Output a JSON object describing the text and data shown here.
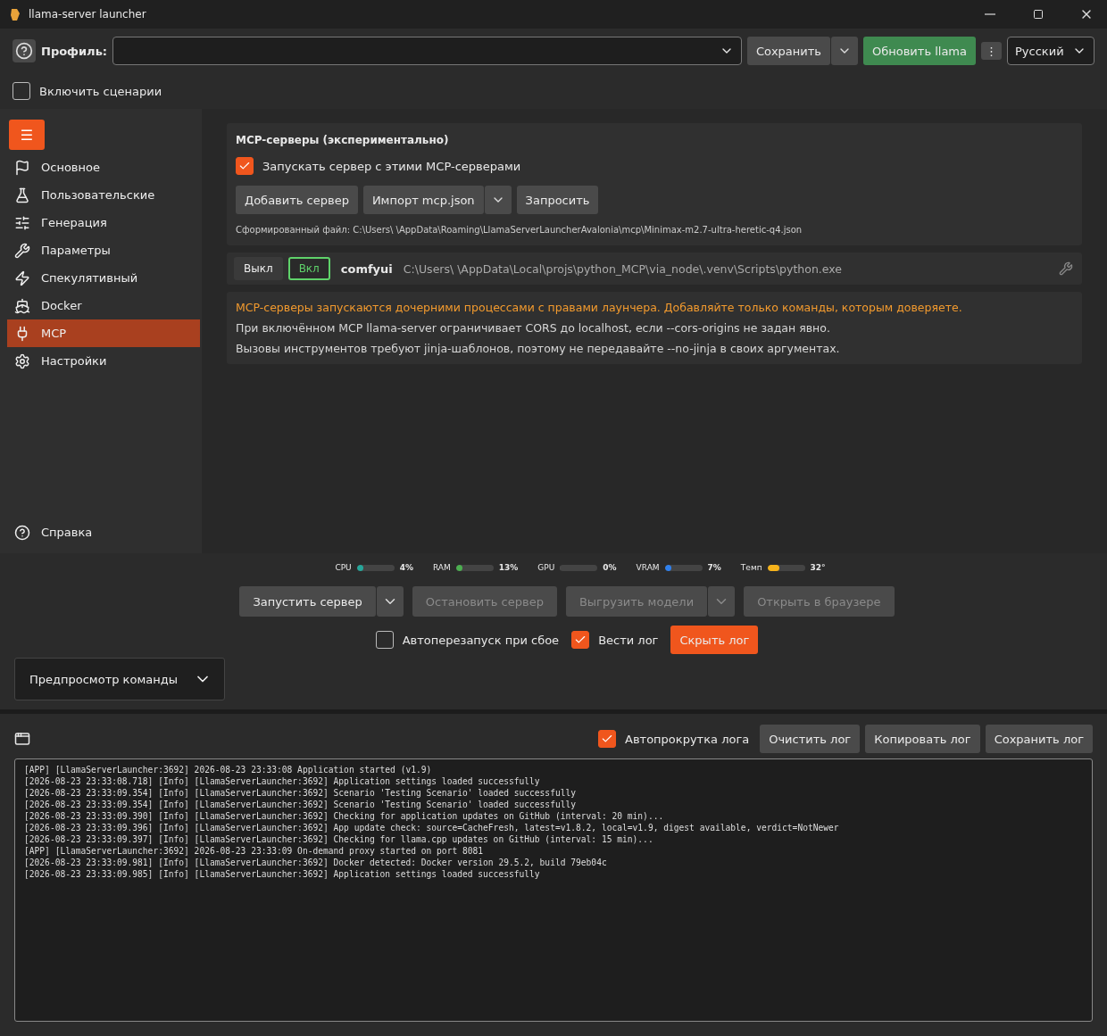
{
  "window": {
    "title": "llama-server launcher"
  },
  "toolbar": {
    "profile_label": "Профиль:",
    "save": "Сохранить",
    "update": "Обновить llama",
    "more": "⋮",
    "language": "Русский"
  },
  "scenarios": {
    "label": "Включить сценарии",
    "checked": false
  },
  "sidebar": {
    "menu": "☰",
    "items": [
      {
        "label": "Основное",
        "selected": false
      },
      {
        "label": "Пользовательские",
        "selected": false
      },
      {
        "label": "Генерация",
        "selected": false
      },
      {
        "label": "Параметры",
        "selected": false
      },
      {
        "label": "Спекулятивный",
        "selected": false
      },
      {
        "label": "Docker",
        "selected": false
      },
      {
        "label": "MCP",
        "selected": true
      },
      {
        "label": "Настройки",
        "selected": false
      }
    ],
    "help": "Справка"
  },
  "mcp": {
    "title": "MCP-серверы (экспериментально)",
    "run_with": {
      "label": "Запускать сервер с этими MCP-серверами",
      "checked": true
    },
    "buttons": [
      "Добавить сервер",
      "Импорт mcp.json",
      "Запросить"
    ],
    "generated_file": "Сформированный файл: C:\\Users\\ \\AppData\\Roaming\\LlamaServerLauncherAvalonia\\mcp\\Minimax-m2.7-ultra-heretic-q4.json",
    "servers": [
      {
        "off": "Выкл",
        "on": "Вкл",
        "enabled": true,
        "name": "comfyui",
        "command": "C:\\Users\\ \\AppData\\Local\\projs\\python_MCP\\via_node\\.venv\\Scripts\\python.exe"
      }
    ],
    "notes": [
      {
        "text": "MCP-серверы запускаются дочерними процессами с правами лаунчера. Добавляйте только команды, которым доверяете.",
        "kind": "warning"
      },
      {
        "text": "При включённом MCP llama-server ограничивает CORS до localhost, если --cors-origins не задан явно.",
        "kind": "info"
      },
      {
        "text": "Вызовы инструментов требуют jinja-шаблонов, поэтому не передавайте --no-jinja в своих аргументах.",
        "kind": "info"
      }
    ]
  },
  "meters": [
    {
      "label": "CPU",
      "level": 0.04,
      "reading": "4%",
      "color": "#26a69a"
    },
    {
      "label": "RAM",
      "level": 0.13,
      "reading": "13%",
      "color": "#4caf50"
    },
    {
      "label": "GPU",
      "level": 0,
      "reading": "0%"
    },
    {
      "label": "VRAM",
      "level": 0.07,
      "reading": "7%",
      "color": "#2f80ed"
    },
    {
      "label": "Темп",
      "level": 0.32,
      "reading": "32°",
      "color": "#f5b21b"
    }
  ],
  "actions": [
    {
      "label": "Запустить сервер",
      "disabled": false,
      "dropdown": true
    },
    {
      "label": "Остановить сервер",
      "disabled": true,
      "dropdown": false
    },
    {
      "label": "Выгрузить модели",
      "disabled": true,
      "dropdown": true
    },
    {
      "label": "Открыть в браузере",
      "disabled": true,
      "dropdown": false
    }
  ],
  "options": [
    {
      "label": "Автоперезапуск при сбое",
      "checked": false
    },
    {
      "label": "Вести лог",
      "checked": true
    }
  ],
  "hide_log": "Скрыть лог",
  "preview": "Предпросмотр команды",
  "log": {
    "autoscroll": {
      "label": "Автопрокрутка лога",
      "checked": true
    },
    "buttons": [
      "Очистить лог",
      "Копировать лог",
      "Сохранить лог"
    ],
    "lines": [
      "[APP] [LlamaServerLauncher:3692] 2026-08-23 23:33:08 Application started (v1.9)",
      "[2026-08-23 23:33:08.718] [Info] [LlamaServerLauncher:3692] Application settings loaded successfully",
      "[2026-08-23 23:33:09.354] [Info] [LlamaServerLauncher:3692] Scenario 'Testing Scenario' loaded successfully",
      "[2026-08-23 23:33:09.354] [Info] [LlamaServerLauncher:3692] Scenario 'Testing Scenario' loaded successfully",
      "[2026-08-23 23:33:09.390] [Info] [LlamaServerLauncher:3692] Checking for application updates on GitHub (interval: 20 min)...",
      "[2026-08-23 23:33:09.396] [Info] [LlamaServerLauncher:3692] App update check: source=CacheFresh, latest=v1.8.2, local=v1.9, digest available, verdict=NotNewer",
      "[2026-08-23 23:33:09.397] [Info] [LlamaServerLauncher:3692] Checking for llama.cpp updates on GitHub (interval: 15 min)...",
      "[APP] [LlamaServerLauncher:3692] 2026-08-23 23:33:09 On-demand proxy started on port 8081",
      "[2026-08-23 23:33:09.981] [Info] [LlamaServerLauncher:3692] Docker detected: Docker version 29.5.2, build 79eb04c",
      "[2026-08-23 23:33:09.985] [Info] [LlamaServerLauncher:3692] Application settings loaded successfully"
    ]
  }
}
